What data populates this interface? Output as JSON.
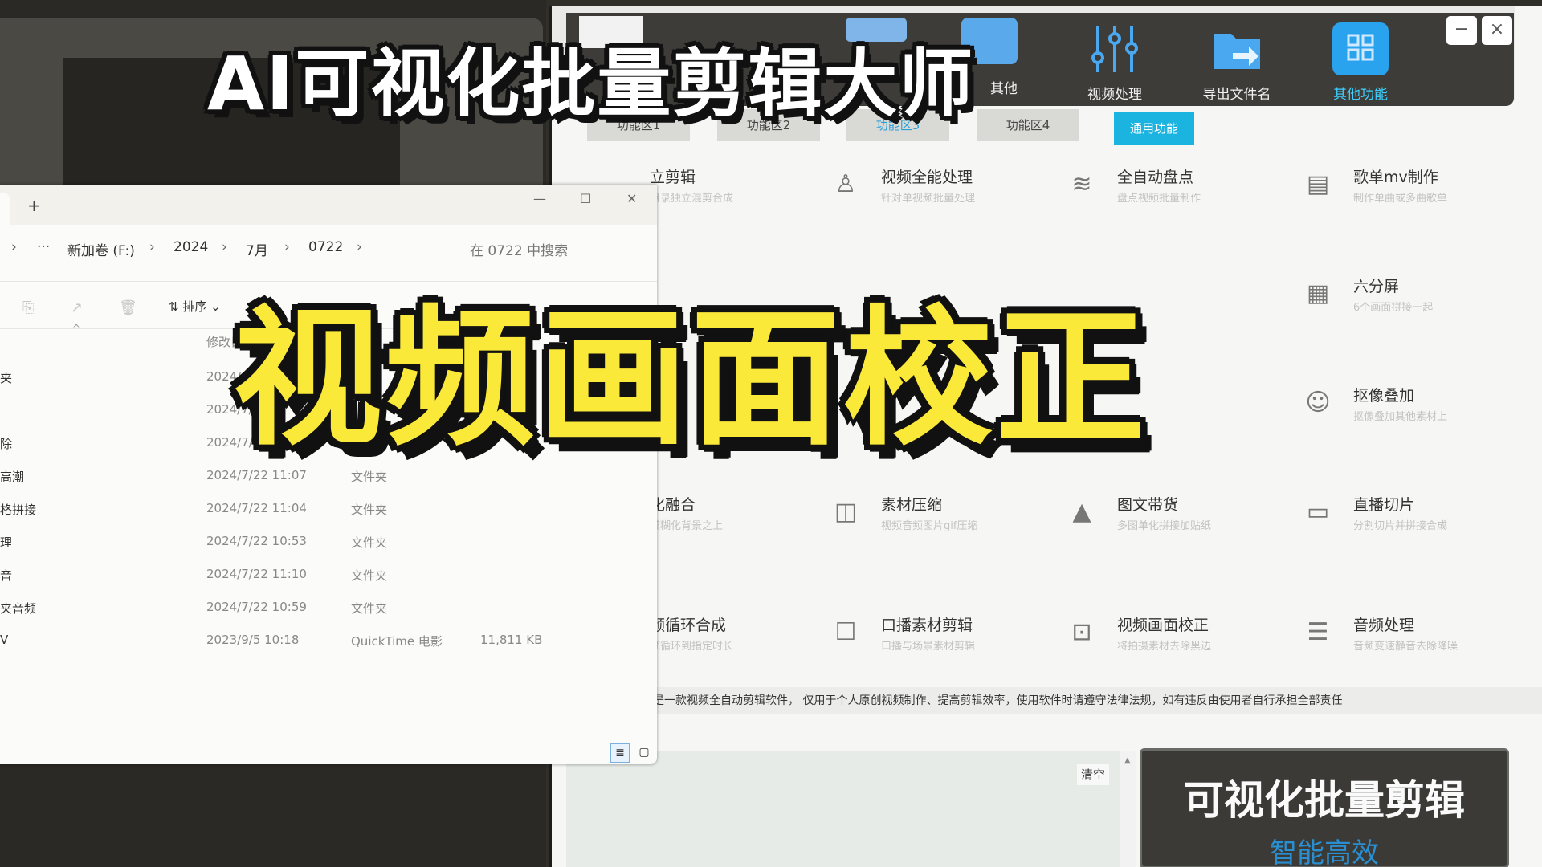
{
  "overlay": {
    "title_top": "AI可视化批量剪辑大师",
    "title_big": "视频画面校正"
  },
  "app": {
    "toolbar": [
      {
        "label": "视频处理",
        "icon": "sliders-icon"
      },
      {
        "label": "导出文件名",
        "icon": "export-icon"
      },
      {
        "label": "其他功能",
        "icon": "grid-icon"
      }
    ],
    "partial_tool_label": "其他",
    "window_buttons": {
      "minimize": "−",
      "close": "×"
    },
    "tabs": [
      "功能区1",
      "功能区2",
      "功能区3",
      "功能区4",
      "通用功能"
    ],
    "selected_tab": "功能区3",
    "cards": [
      {
        "title": "立剪辑",
        "sub": "目录独立混剪合成",
        "icon": "scissors-icon"
      },
      {
        "title": "视频全能处理",
        "sub": "针对单视频批量处理",
        "icon": "basket-icon"
      },
      {
        "title": "全自动盘点",
        "sub": "盘点视频批量制作",
        "icon": "layers-icon"
      },
      {
        "title": "歌单mv制作",
        "sub": "制作单曲或多曲歌单",
        "icon": "document-icon"
      },
      {
        "title": "六分屏",
        "sub": "6个画面拼接一起",
        "icon": "six-grid-icon"
      },
      {
        "title": "抠像叠加",
        "sub": "抠像叠加其他素材上",
        "icon": "portrait-icon"
      },
      {
        "title": "化融合",
        "sub": "模糊化背景之上",
        "icon": "blend-icon"
      },
      {
        "title": "素材压缩",
        "sub": "视频音频图片gif压缩",
        "icon": "compress-icon"
      },
      {
        "title": "图文带货",
        "sub": "多图单化拼接加贴纸",
        "icon": "image-icon"
      },
      {
        "title": "直播切片",
        "sub": "分割切片并拼接合成",
        "icon": "camera-icon"
      },
      {
        "title": "频循环合成",
        "sub": "频循环到指定时长",
        "icon": "loop-icon"
      },
      {
        "title": "口播素材剪辑",
        "sub": "口播与场景素材剪辑",
        "icon": "robot-icon"
      },
      {
        "title": "视频画面校正",
        "sub": "将拍摄素材去除黑边",
        "icon": "crop-icon"
      },
      {
        "title": "音频处理",
        "sub": "音频变速静音去除降噪",
        "icon": "equalizer-icon"
      }
    ],
    "notice": "是一款视频全自动剪辑软件， 仅用于个人原创视频制作、提高剪辑效率，使用软件时请遵守法律法规，如有违反由使用者自行承担全部责任",
    "clear_label": "清空",
    "promo": {
      "line1": "可视化批量剪辑",
      "line2": "智能高效"
    }
  },
  "explorer": {
    "new_tab": "+",
    "window_buttons": {
      "minimize": "—",
      "maximize": "☐",
      "close": "✕"
    },
    "breadcrumbs": [
      "新加卷 (F:)",
      "2024",
      "7月",
      "0722"
    ],
    "search_placeholder": "在 0722 中搜索",
    "sort_label": "排序",
    "column_date": "修改日期",
    "rows": [
      {
        "name": "夹",
        "date": "2024/",
        "type": "",
        "size": ""
      },
      {
        "name": "",
        "date": "2024/7/",
        "type": "",
        "size": ""
      },
      {
        "name": "除",
        "date": "2024/7/",
        "type": "",
        "size": ""
      },
      {
        "name": "高潮",
        "date": "2024/7/22 11:07",
        "type": "文件夹",
        "size": ""
      },
      {
        "name": "格拼接",
        "date": "2024/7/22 11:04",
        "type": "文件夹",
        "size": ""
      },
      {
        "name": "理",
        "date": "2024/7/22 10:53",
        "type": "文件夹",
        "size": ""
      },
      {
        "name": "音",
        "date": "2024/7/22 11:10",
        "type": "文件夹",
        "size": ""
      },
      {
        "name": "夹音频",
        "date": "2024/7/22 10:59",
        "type": "文件夹",
        "size": ""
      },
      {
        "name": "V",
        "date": "2023/9/5 10:18",
        "type": "QuickTime 电影",
        "size": "11,811 KB"
      }
    ]
  }
}
